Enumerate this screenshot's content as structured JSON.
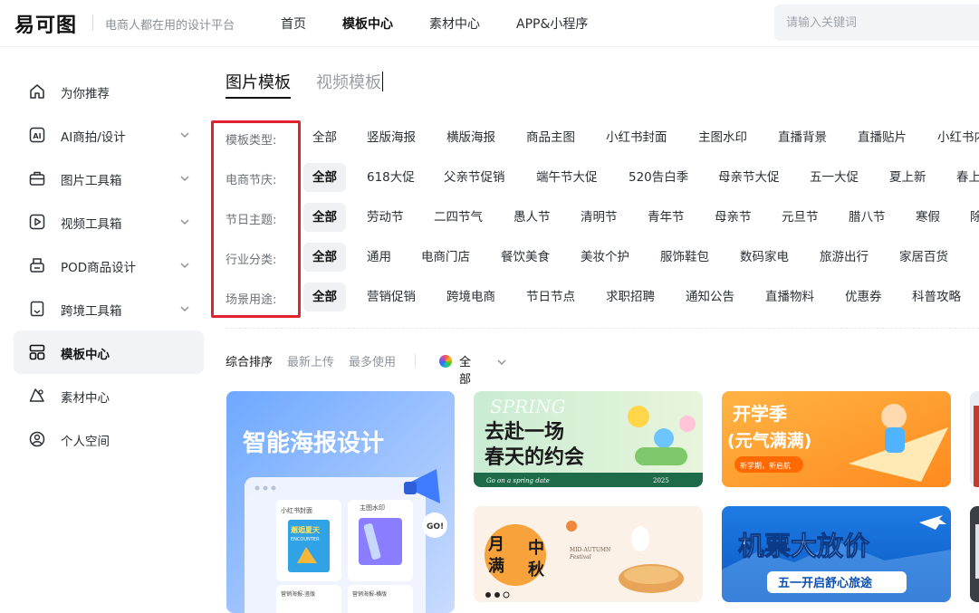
{
  "header": {
    "logo": "易可图",
    "slogan": "电商人都在用的设计平台",
    "nav": [
      "首页",
      "模板中心",
      "素材中心",
      "APP&小程序"
    ],
    "active_nav": "模板中心",
    "search_placeholder": "请输入关键词"
  },
  "sidebar": {
    "items": [
      {
        "label": "为你推荐",
        "icon": "home-icon",
        "expandable": false
      },
      {
        "label": "AI商拍/设计",
        "icon": "ai-icon",
        "expandable": true
      },
      {
        "label": "图片工具箱",
        "icon": "toolbox-icon",
        "expandable": true
      },
      {
        "label": "视频工具箱",
        "icon": "video-icon",
        "expandable": true
      },
      {
        "label": "POD商品设计",
        "icon": "printer-icon",
        "expandable": true
      },
      {
        "label": "跨境工具箱",
        "icon": "bookmark-icon",
        "expandable": true
      },
      {
        "label": "模板中心",
        "icon": "grid-icon",
        "expandable": false
      },
      {
        "label": "素材中心",
        "icon": "shapes-icon",
        "expandable": false
      },
      {
        "label": "个人空间",
        "icon": "user-icon",
        "expandable": false
      }
    ],
    "active": "模板中心"
  },
  "tabs": {
    "items": [
      "图片模板",
      "视频模板"
    ],
    "active": "图片模板"
  },
  "filters": [
    {
      "label": "模板类型:",
      "options": [
        "全部",
        "竖版海报",
        "横版海报",
        "商品主图",
        "小红书封面",
        "主图水印",
        "直播背景",
        "直播贴片",
        "小红书内"
      ],
      "selected": -1
    },
    {
      "label": "电商节庆:",
      "options": [
        "全部",
        "618大促",
        "父亲节促销",
        "端午节大促",
        "520告白季",
        "母亲节大促",
        "五一大促",
        "夏上新",
        "春上"
      ],
      "selected": 0
    },
    {
      "label": "节日主题:",
      "options": [
        "全部",
        "劳动节",
        "二四节气",
        "愚人节",
        "清明节",
        "青年节",
        "母亲节",
        "元旦节",
        "腊八节",
        "寒假",
        "除"
      ],
      "selected": 0
    },
    {
      "label": "行业分类:",
      "options": [
        "全部",
        "通用",
        "电商门店",
        "餐饮美食",
        "美妆个护",
        "服饰鞋包",
        "数码家电",
        "旅游出行",
        "家居百货"
      ],
      "selected": 0
    },
    {
      "label": "场景用途:",
      "options": [
        "全部",
        "营销促销",
        "跨境电商",
        "节日节点",
        "求职招聘",
        "通知公告",
        "直播物料",
        "优惠券",
        "科普攻略"
      ],
      "selected": 0
    }
  ],
  "sort": {
    "items": [
      "综合排序",
      "最新上传",
      "最多使用"
    ],
    "active": "综合排序",
    "color_filter": "全部"
  },
  "cards": {
    "feature": {
      "title": "智能海报设计",
      "mini1": "小红书封面",
      "mini2": "主图水印",
      "mini3": "营销海报-竖版",
      "mini4": "营销海报-横版",
      "poster_text": "邂逅夏天",
      "poster_sub": "ENCOUNTER",
      "go": "GO!"
    },
    "spring": {
      "line1": "去赴一场",
      "line2": "春天的约会",
      "bg_text": "SPRING",
      "sub": "Go on a spring date",
      "year": "2025"
    },
    "school": {
      "line1": "开学季",
      "line2": "(元气满满)",
      "tag": "新学期，新启航"
    },
    "autumn": {
      "c1": "月",
      "c2": "中",
      "c3": "满",
      "c4": "秋",
      "en": "MID-AUTUMN",
      "en2": "Festival"
    },
    "flight": {
      "title": "机票大放价",
      "sub": "五一开启舒心旅途"
    }
  },
  "colors": {
    "accent_red": "#e0242f",
    "selected_chip_bg": "#f0f1f4",
    "sidebar_active_bg": "#f2f3f6"
  }
}
